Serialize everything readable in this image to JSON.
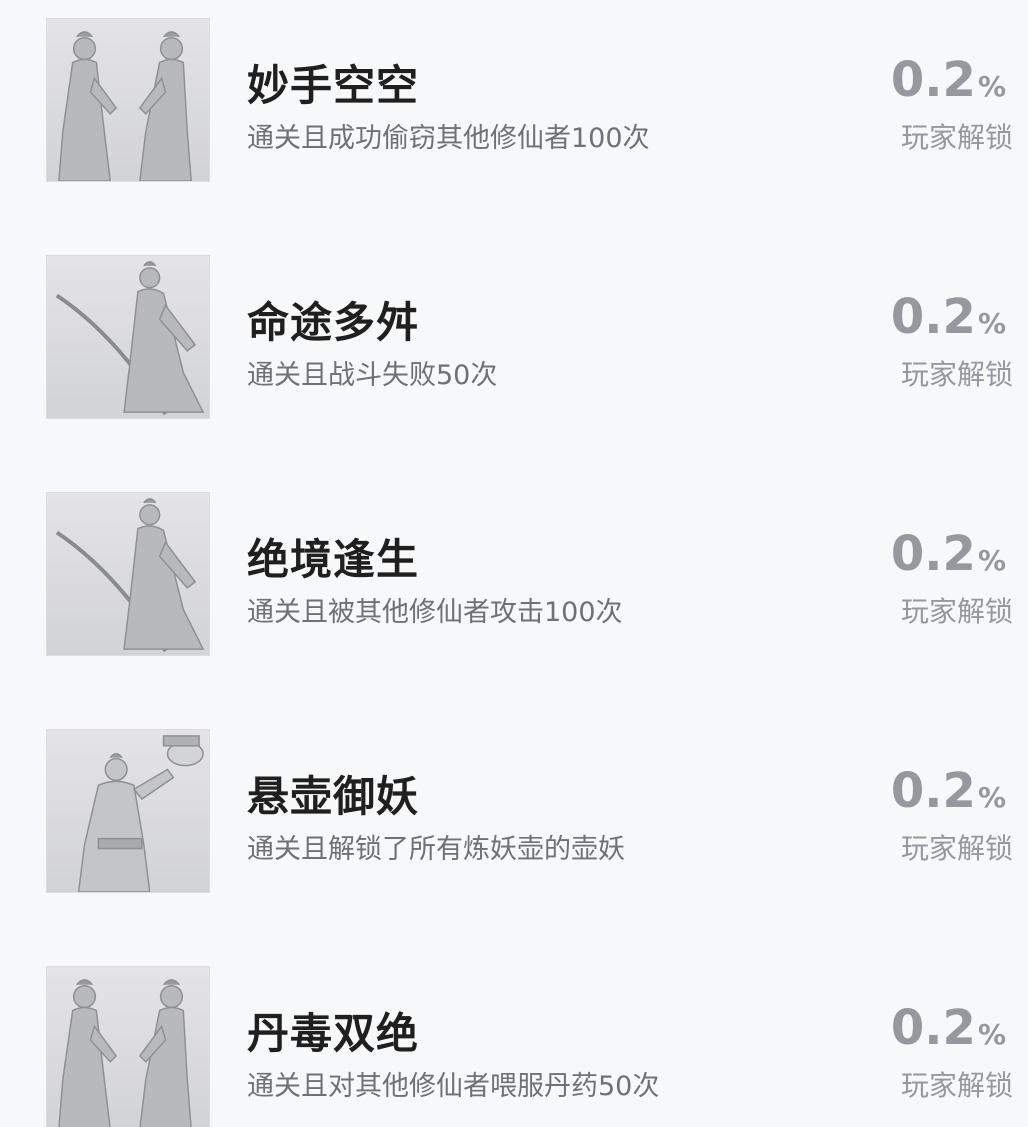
{
  "achievements": [
    {
      "title": "妙手空空",
      "desc": "通关且成功偷窃其他修仙者100次",
      "percent": "0.2",
      "unit": "%",
      "unlock_label": "玩家解锁",
      "icon": "two-figures-icon"
    },
    {
      "title": "命途多舛",
      "desc": "通关且战斗失败50次",
      "percent": "0.2",
      "unit": "%",
      "unlock_label": "玩家解锁",
      "icon": "swordsman-icon"
    },
    {
      "title": "绝境逢生",
      "desc": "通关且被其他修仙者攻击100次",
      "percent": "0.2",
      "unit": "%",
      "unlock_label": "玩家解锁",
      "icon": "swordsman-icon"
    },
    {
      "title": "悬壶御妖",
      "desc": "通关且解锁了所有炼妖壶的壶妖",
      "percent": "0.2",
      "unit": "%",
      "unlock_label": "玩家解锁",
      "icon": "gourd-holder-icon"
    },
    {
      "title": "丹毒双绝",
      "desc": "通关且对其他修仙者喂服丹药50次",
      "percent": "0.2",
      "unit": "%",
      "unlock_label": "玩家解锁",
      "icon": "two-figures-icon"
    }
  ]
}
